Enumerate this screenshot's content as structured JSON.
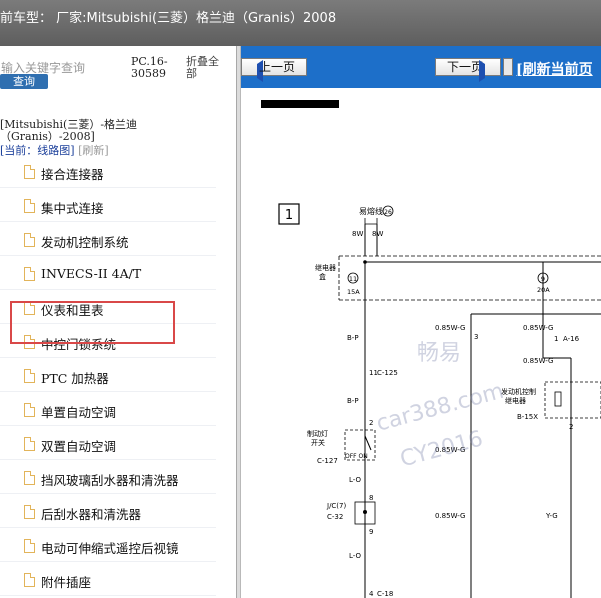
{
  "header": {
    "title": "前车型：  厂家:Mitsubishi(三菱）格兰迪（Granis）2008"
  },
  "left_panel": {
    "search_placeholder": "输入关键字查询",
    "query_button": "查询",
    "pc_code": "PC.16-30589",
    "fold_all": "折叠全部",
    "car_desc": "[Mitsubishi(三菱）-格兰迪（Granis）-2008]",
    "current_label": "[当前：线路图]",
    "refresh_small": "[刷新]",
    "menu_items": [
      {
        "label": "接合连接器"
      },
      {
        "label": "集中式连接"
      },
      {
        "label": "发动机控制系统"
      },
      {
        "label": "INVECS-II 4A/T"
      },
      {
        "label": "仪表和里表"
      },
      {
        "label": "中控门锁系统"
      },
      {
        "label": "PTC 加热器"
      },
      {
        "label": "单置自动空调"
      },
      {
        "label": "双置自动空调"
      },
      {
        "label": "挡风玻璃刮水器和清洗器"
      },
      {
        "label": "后刮水器和清洗器"
      },
      {
        "label": "电动可伸缩式遥控后视镜"
      },
      {
        "label": "附件插座"
      }
    ]
  },
  "toolbar": {
    "prev_label": "上一页",
    "next_label": "下一页",
    "refresh_label": "[刷新当前页"
  },
  "diagram": {
    "box_number": "1",
    "fusible_link": "易熔线",
    "fusible_num": "26",
    "w8a": "8W",
    "w8b": "8W",
    "relay_box": "继电器",
    "relay_box2": "盒",
    "fuse11": "11",
    "amp15": "15A",
    "fuse9": "9",
    "amp20": "20A",
    "bp1": "B-P",
    "bp2": "B-P",
    "w085a": "0.85W-G",
    "w085b": "0.85W-G",
    "w085c": "0.85W-G",
    "w085d": "0.85W-G",
    "w085e": "0.85W-G",
    "n3a": "3",
    "n1": "1",
    "a16": "A-16",
    "c125": "C-125",
    "n11": "11",
    "engine_relay": "发动机控制",
    "engine_relay2": "继电器",
    "b15x": "B-15X",
    "n2a": "2",
    "n2b": "2",
    "brake_switch": "制动灯",
    "brake_switch2": "开关",
    "c127": "C-127",
    "off_on": "OFF ON",
    "jc7": "J/C(7)",
    "c32": "C-32",
    "n8": "8",
    "n9": "9",
    "lo1": "L-O",
    "lo2": "L-O",
    "yg": "Y-G",
    "c18": "C-18",
    "n4": "4",
    "wm1": "畅易",
    "wm2": "car388.com",
    "wm3": "CY2016"
  }
}
